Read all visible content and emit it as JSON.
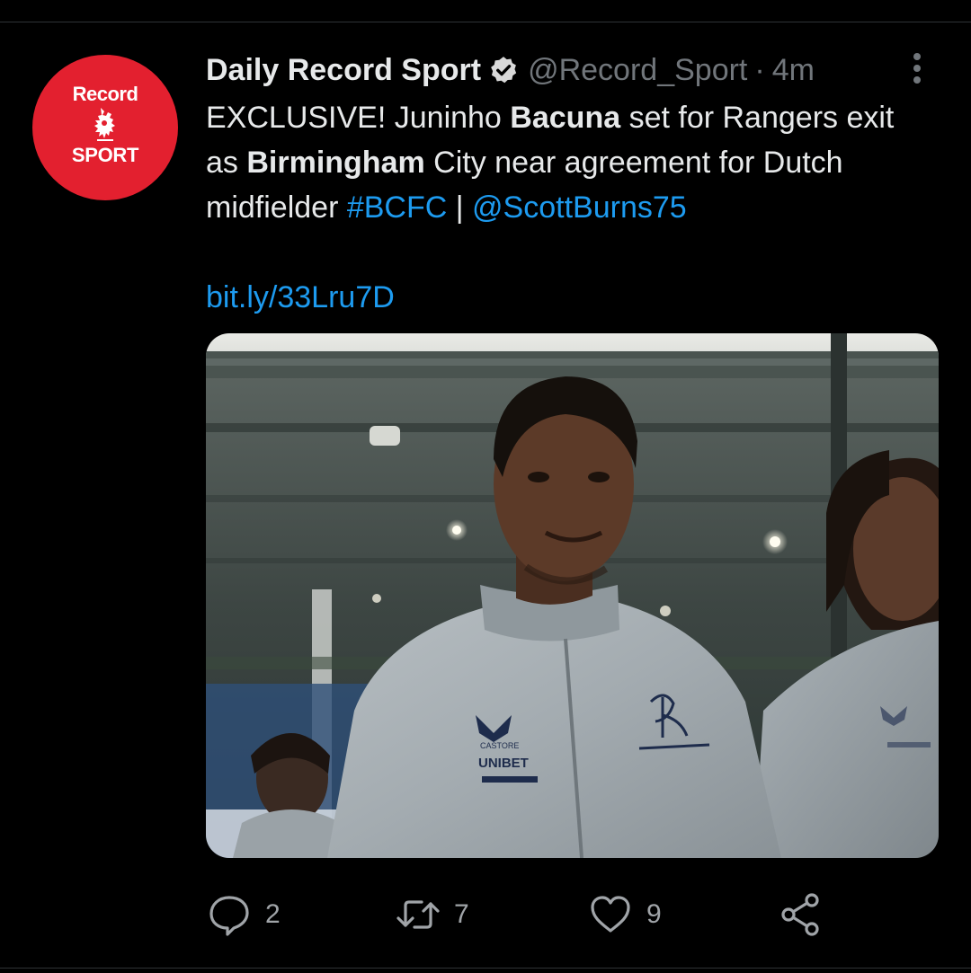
{
  "tweet": {
    "avatar": {
      "text_top": "Record",
      "text_bottom": "SPORT"
    },
    "author": {
      "display_name": "Daily Record Sport",
      "handle": "@Record_Sport",
      "separator": "·",
      "time": "4m",
      "verified": true
    },
    "text": {
      "t1": "EXCLUSIVE! Juninho ",
      "b1": "Bacuna",
      "t2": " set for Rangers exit as ",
      "b2": "Birmingham",
      "t3": " City near agreement for Dutch midfielder ",
      "hashtag": "#BCFC",
      "t4": " | ",
      "mention": "@ScottBurns75"
    },
    "link": "bit.ly/33Lru7D",
    "media": {
      "jacket_brand": "CASTORE",
      "sponsor": "UNIBET"
    },
    "stats": {
      "replies": "2",
      "retweets": "7",
      "likes": "9"
    }
  },
  "colors": {
    "background": "#000000",
    "text": "#e7e9ea",
    "secondary": "#71767b",
    "link": "#1d9bf0",
    "avatar_red": "#e3202f",
    "divider": "#2f3336"
  }
}
